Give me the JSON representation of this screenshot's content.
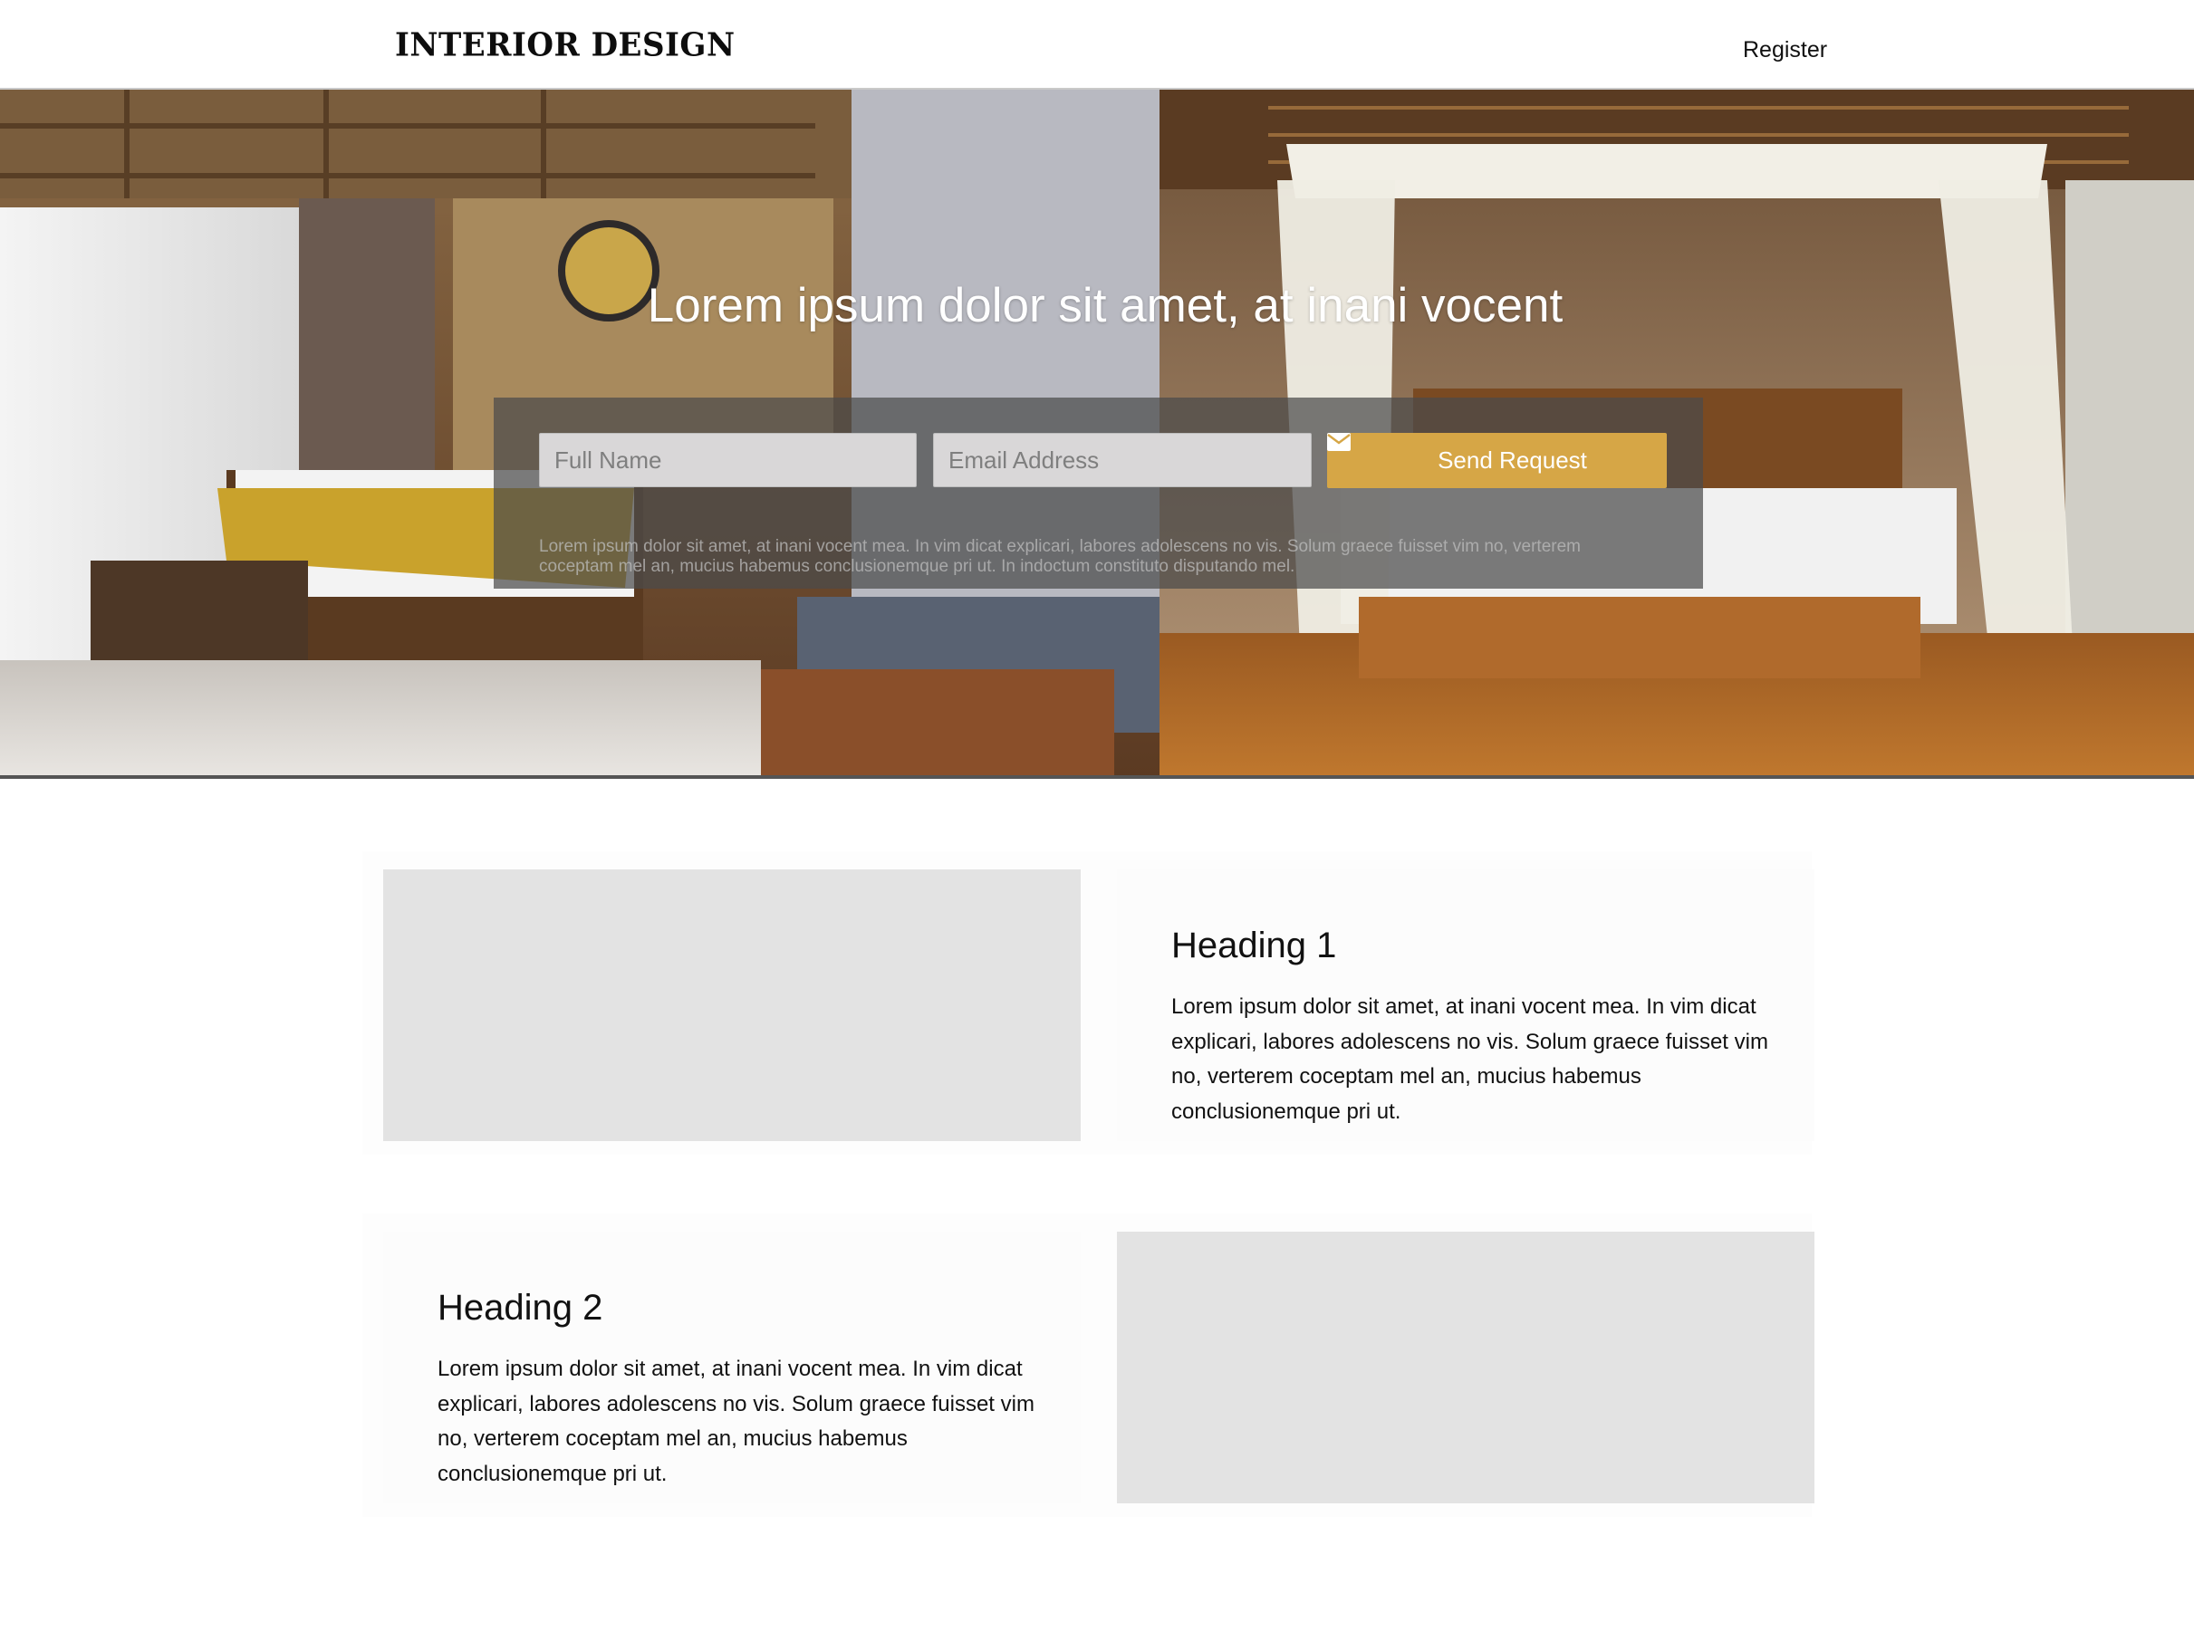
{
  "header": {
    "brand": "INTERIOR DESIGN",
    "register_label": "Register"
  },
  "hero": {
    "title": "Lorem ipsum dolor sit amet, at inani vocent",
    "form": {
      "name_placeholder": "Full Name",
      "email_placeholder": "Email Address",
      "send_label": "Send Request",
      "note": "Lorem ipsum dolor sit amet, at inani vocent mea. In vim dicat explicari, labores adolescens no vis. Solum graece fuisset vim no, verterem coceptam mel an, mucius habemus conclusionemque pri ut. In indoctum constituto disputando mel."
    }
  },
  "sections": [
    {
      "heading": "Heading 1",
      "body": "Lorem ipsum dolor sit amet, at inani vocent mea. In vim dicat explicari, labores adolescens no vis. Solum graece fuisset vim no, verterem coceptam mel an, mucius habemus conclusionemque pri ut."
    },
    {
      "heading": "Heading 2",
      "body": "Lorem ipsum dolor sit amet, at inani vocent mea. In vim dicat explicari, labores adolescens no vis. Solum graece fuisset vim no, verterem coceptam mel an, mucius habemus conclusionemque pri ut."
    }
  ],
  "colors": {
    "accent": "#d6a646",
    "placeholder_box": "#e3e3e3"
  },
  "icons": {
    "send": "envelope-icon"
  }
}
